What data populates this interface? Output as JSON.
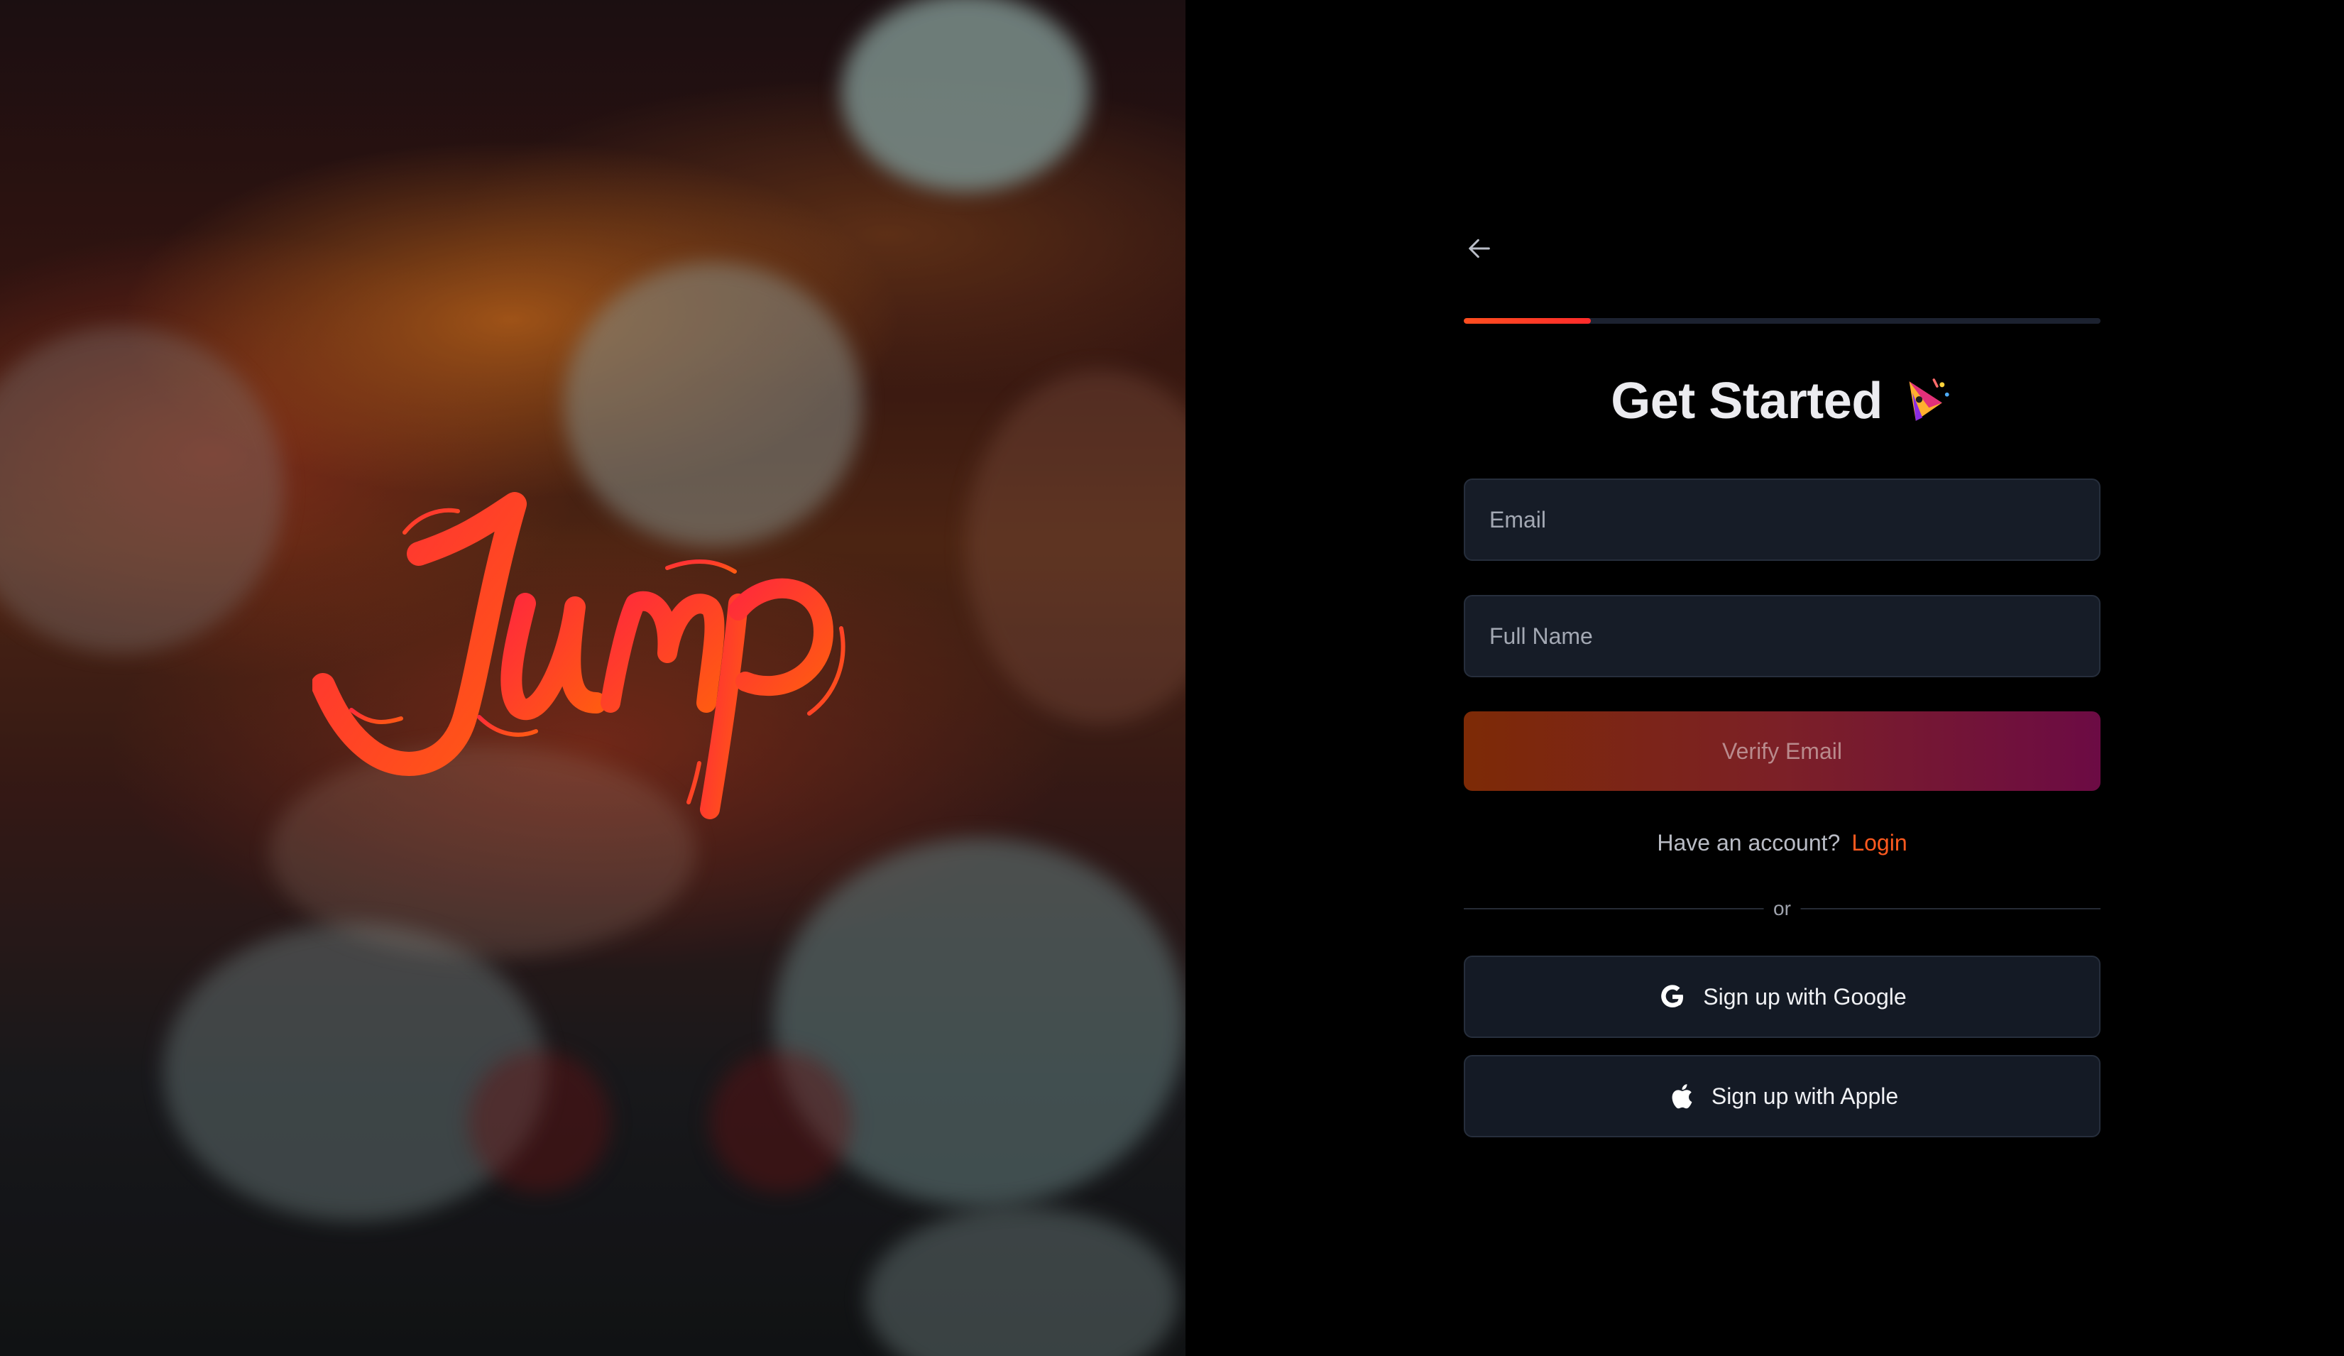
{
  "hero": {
    "logo_text": "Jump",
    "brand_color": "#ff4e1f"
  },
  "form": {
    "back_icon": "arrow-left-icon",
    "progress": 0.2,
    "title": "Get Started",
    "title_emoji": "party-popper-icon",
    "email_placeholder": "Email",
    "email_value": "",
    "fullname_placeholder": "Full Name",
    "fullname_value": "",
    "verify_label": "Verify Email",
    "account_prompt": "Have an account?",
    "login_label": "Login",
    "divider_text": "or",
    "google_label": "Sign up with Google",
    "google_icon": "google-icon",
    "apple_label": "Sign up with Apple",
    "apple_icon": "apple-icon"
  },
  "colors": {
    "accent": "#ff5a1f",
    "background": "#000000",
    "input_bg": "#161c27",
    "button_gradient_start": "#7d2a06",
    "button_gradient_end": "#6c0b44"
  }
}
